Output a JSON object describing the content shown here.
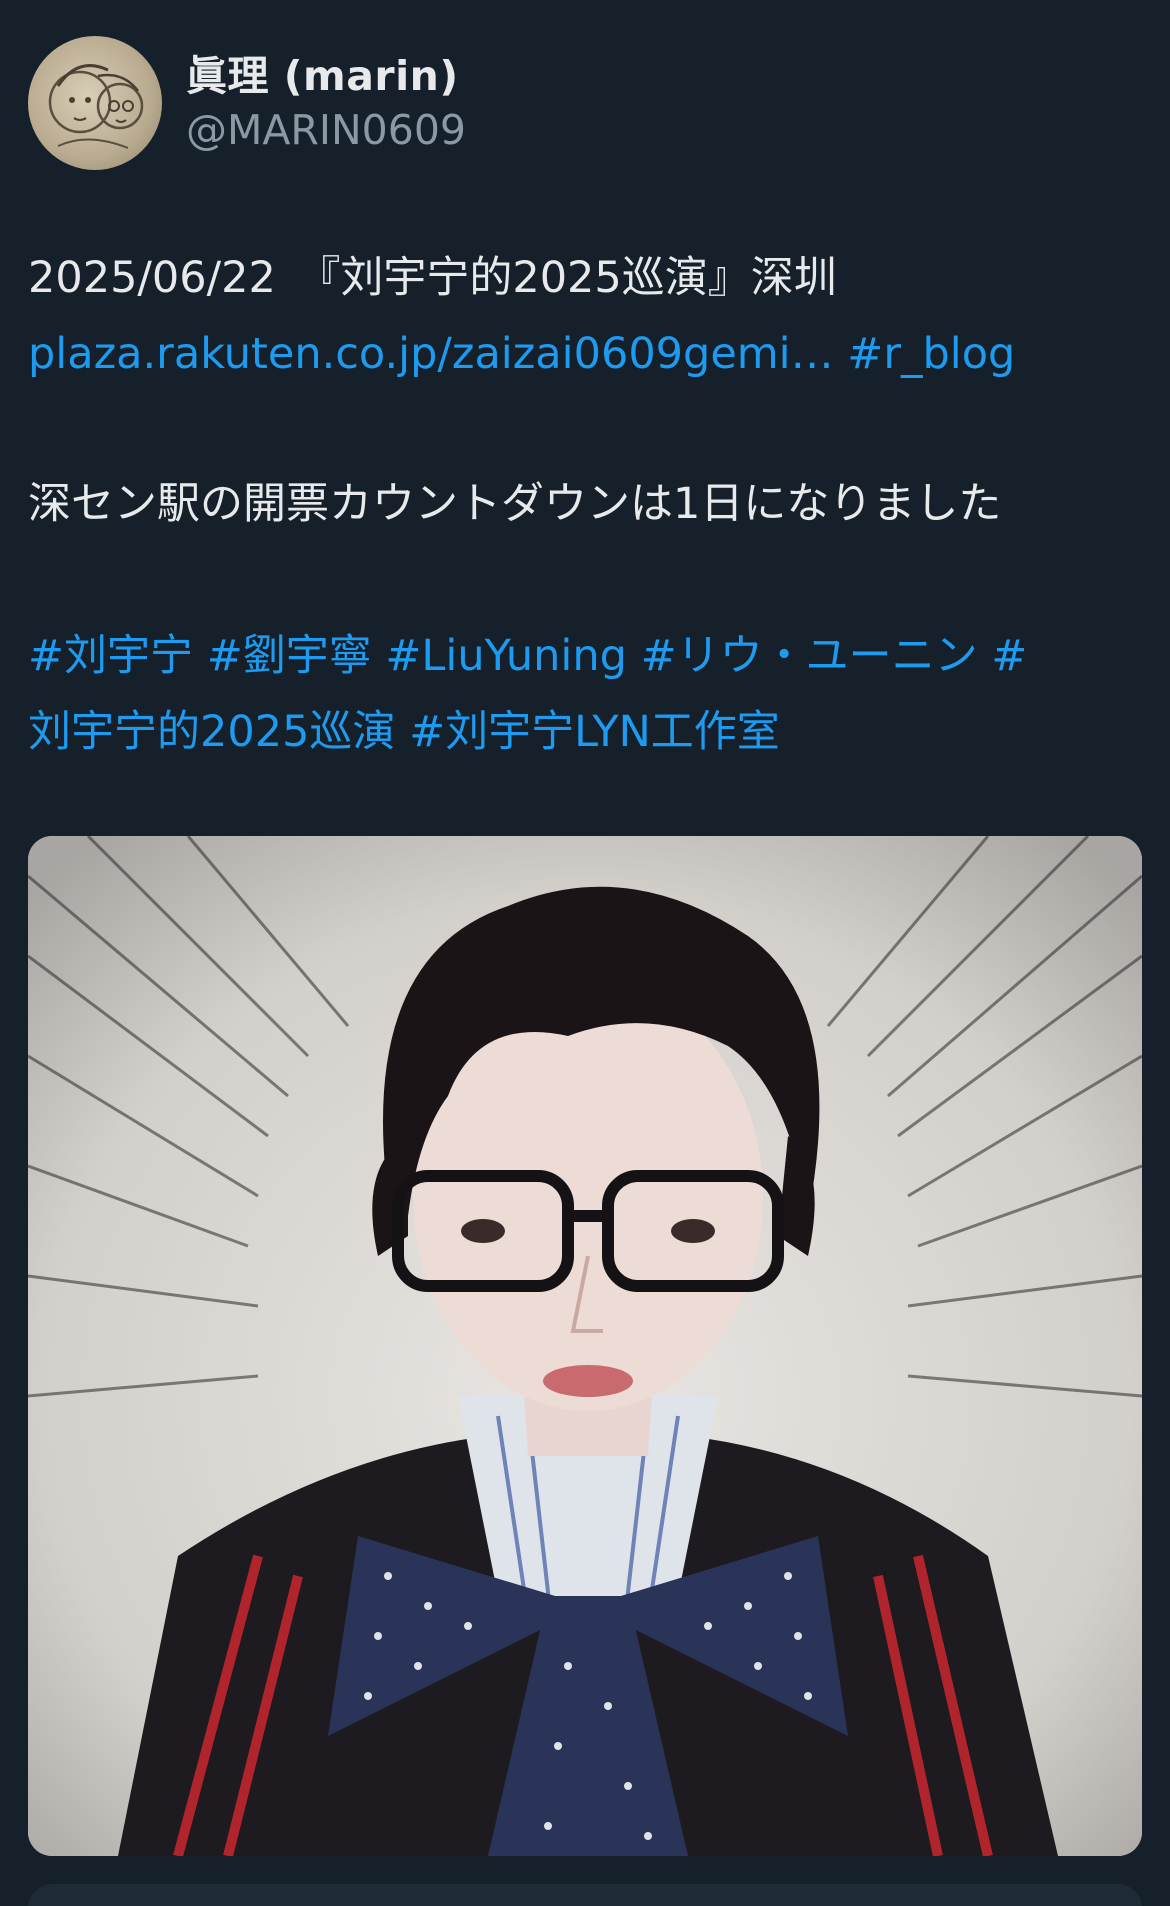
{
  "header": {
    "display_name": "眞理 (marin)",
    "handle": "@MARIN0609",
    "avatar_icon": "avatar-illustration"
  },
  "tweet": {
    "line1": "2025/06/22　『刘宇宁的2025巡演』深圳",
    "link_url_text": "plaza.rakuten.co.jp/zaizai0609gemi…",
    "link_hashtag": "#r_blog",
    "body_text": "深セン駅の開票カウントダウンは1日になりました",
    "hashtags_line1": "#刘宇宁 #劉宇寧 #LiuYuning #リウ・ユーニン #",
    "hashtags_line2": "刘宇宁的2025巡演 #刘宇宁LYN工作室"
  },
  "colors": {
    "background": "#15202b",
    "text": "#e7e9ea",
    "secondary": "#8b98a5",
    "link": "#1d9bf0"
  }
}
